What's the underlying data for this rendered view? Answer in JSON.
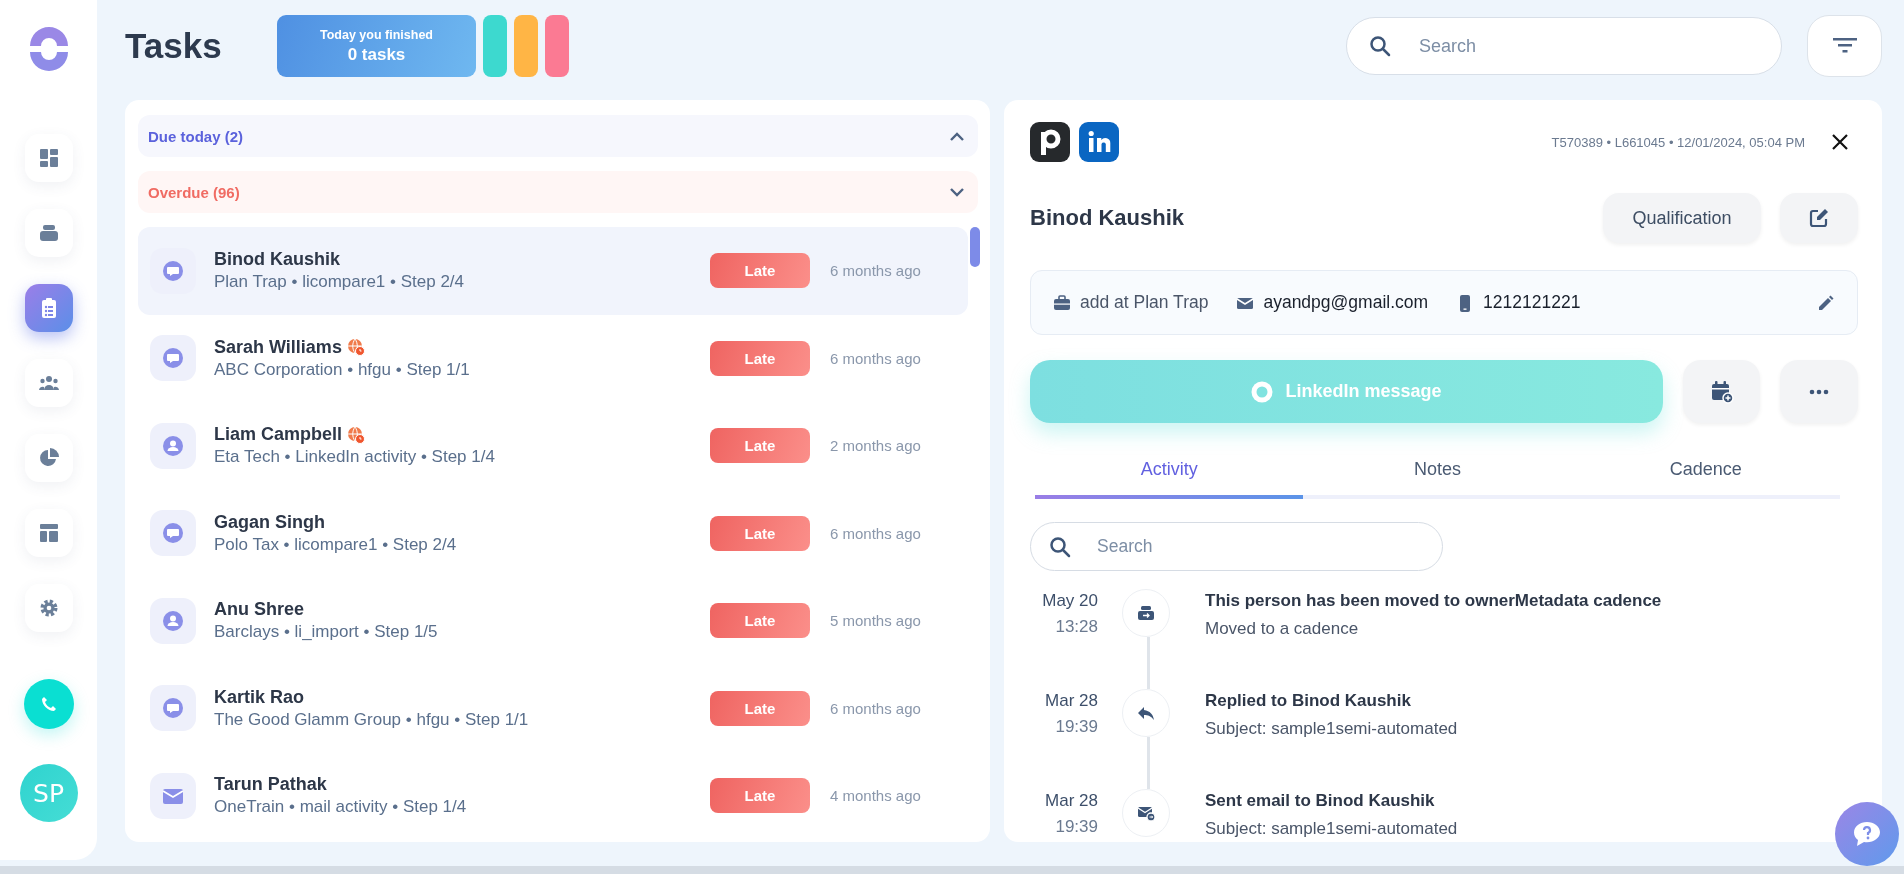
{
  "sidebar": {
    "items": [
      {
        "selected": false
      },
      {
        "selected": false
      },
      {
        "selected": true
      },
      {
        "selected": false
      },
      {
        "selected": false
      },
      {
        "selected": false
      },
      {
        "selected": false
      }
    ],
    "avatar": {
      "initials": "SP"
    }
  },
  "header": {
    "title": "Tasks",
    "finished": {
      "label": "Today you finished",
      "value": "0 tasks"
    },
    "pills": [
      {
        "color": "#3dd9cf"
      },
      {
        "color": "#ffb545"
      },
      {
        "color": "#fb7a93"
      }
    ],
    "search": {
      "placeholder": "Search"
    }
  },
  "sections": [
    {
      "label": "Due today (2)",
      "kind": "due",
      "expanded": true
    },
    {
      "label": "Overdue (96)",
      "kind": "overdue",
      "expanded": false
    }
  ],
  "tasks": [
    {
      "name": "Binod Kaushik",
      "meta": "Plan Trap • licompare1 • Step 2/4",
      "kind": "message",
      "flagged": false,
      "status": "Late",
      "age": "6 months ago",
      "selected": true
    },
    {
      "name": "Sarah Williams",
      "meta": "ABC Corporation • hfgu • Step 1/1",
      "kind": "message",
      "flagged": true,
      "status": "Late",
      "age": "6 months ago",
      "selected": false
    },
    {
      "name": "Liam Campbell",
      "meta": "Eta Tech • LinkedIn activity • Step 1/4",
      "kind": "person",
      "flagged": true,
      "status": "Late",
      "age": "2 months ago",
      "selected": false
    },
    {
      "name": "Gagan Singh",
      "meta": "Polo Tax • licompare1 • Step 2/4",
      "kind": "message",
      "flagged": false,
      "status": "Late",
      "age": "6 months ago",
      "selected": false
    },
    {
      "name": "Anu Shree",
      "meta": "Barclays • li_import • Step 1/5",
      "kind": "person",
      "flagged": false,
      "status": "Late",
      "age": "5 months ago",
      "selected": false
    },
    {
      "name": "Kartik Rao",
      "meta": "The Good Glamm Group • hfgu • Step 1/1",
      "kind": "message",
      "flagged": false,
      "status": "Late",
      "age": "6 months ago",
      "selected": false
    },
    {
      "name": "Tarun Pathak",
      "meta": "OneTrain • mail activity • Step 1/4",
      "kind": "mail",
      "flagged": false,
      "status": "Late",
      "age": "4 months ago",
      "selected": false
    }
  ],
  "detail": {
    "meta": "T570389 • L661045 • 12/01/2024, 05:04 PM",
    "name": "Binod Kaushik",
    "qualification": "Qualification",
    "info": [
      {
        "kind": "company",
        "text": "add at Plan Trap"
      },
      {
        "kind": "email",
        "text": "ayandpg@gmail.com"
      },
      {
        "kind": "phone",
        "text": "1212121221"
      }
    ],
    "action": "LinkedIn message",
    "tabs": [
      {
        "label": "Activity",
        "selected": true
      },
      {
        "label": "Notes",
        "selected": false
      },
      {
        "label": "Cadence",
        "selected": false
      }
    ],
    "search": {
      "placeholder": "Search"
    },
    "timeline": [
      {
        "kind": "cadence",
        "date": "May 20",
        "time": "13:28",
        "title": "This person has been moved to ownerMetadata cadence",
        "subtitle": "Moved to a cadence"
      },
      {
        "kind": "reply",
        "date": "Mar 28",
        "time": "19:39",
        "title": "Replied to Binod Kaushik",
        "subtitle": "Subject: sample1semi-automated"
      },
      {
        "kind": "email",
        "date": "Mar 28",
        "time": "19:39",
        "title": "Sent email to Binod Kaushik",
        "subtitle": "Subject: sample1semi-automated"
      }
    ]
  }
}
